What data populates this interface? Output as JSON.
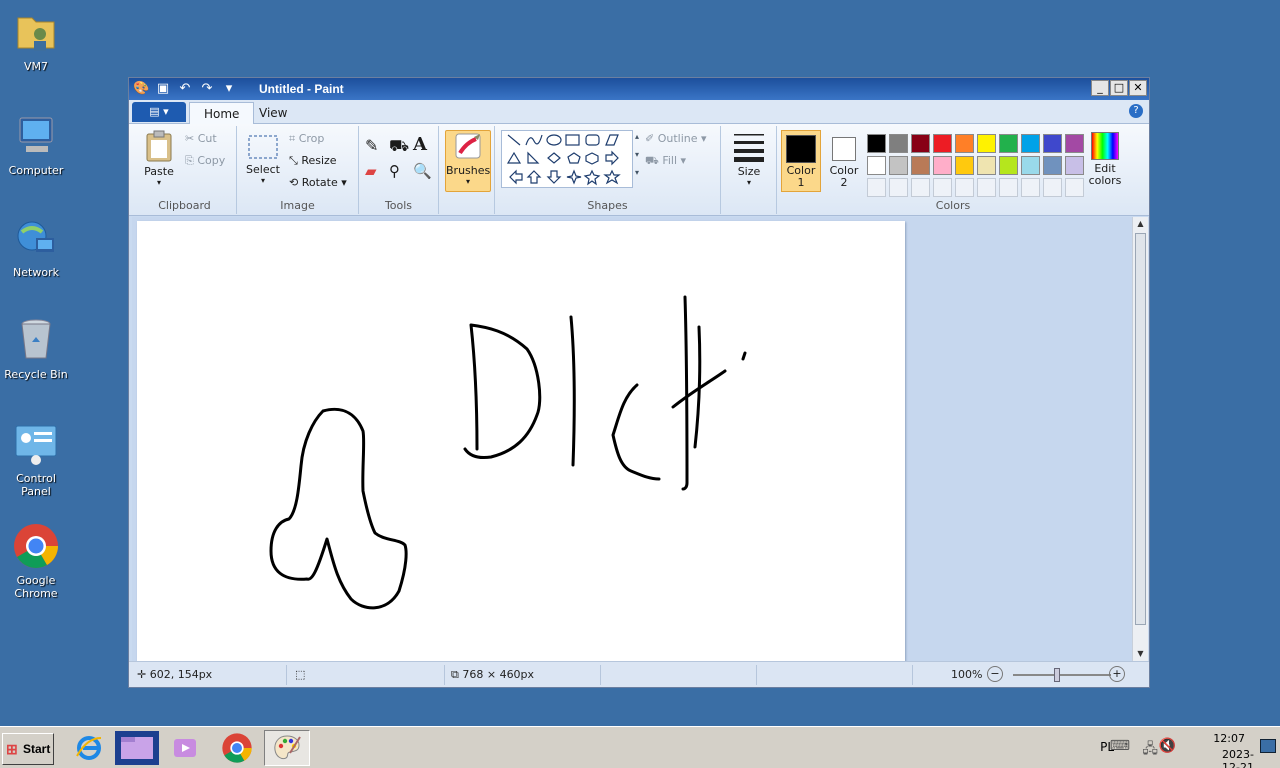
{
  "desktop": {
    "icons": [
      {
        "label": "VM7",
        "icon": "user-folder-icon"
      },
      {
        "label": "Computer",
        "icon": "computer-icon"
      },
      {
        "label": "Network",
        "icon": "network-icon"
      },
      {
        "label": "Recycle Bin",
        "icon": "recycle-bin-icon"
      },
      {
        "label": "Control Panel",
        "icon": "control-panel-icon"
      },
      {
        "label": "Google Chrome",
        "icon": "chrome-icon"
      }
    ]
  },
  "window": {
    "title": "Untitled - Paint",
    "tabs": [
      "Home",
      "View"
    ],
    "clipboard": {
      "paste": "Paste",
      "cut": "Cut",
      "copy": "Copy",
      "label": "Clipboard"
    },
    "image": {
      "select": "Select",
      "crop": "Crop",
      "resize": "Resize",
      "rotate": "Rotate",
      "label": "Image"
    },
    "tools": {
      "label": "Tools"
    },
    "brushes": {
      "label": "Brushes"
    },
    "shapes": {
      "outline": "Outline",
      "fill": "Fill",
      "label": "Shapes"
    },
    "size": {
      "label": "Size"
    },
    "colors": {
      "color1": "Color 1",
      "color2": "Color 2",
      "edit": "Edit colors",
      "label": "Colors",
      "color1_value": "#000000",
      "color2_value": "#ffffff",
      "palette_row1": [
        "#000000",
        "#7f7f7f",
        "#880015",
        "#ed1c24",
        "#ff7f27",
        "#fff200",
        "#22b14c",
        "#00a2e8",
        "#3f48cc",
        "#a349a4"
      ],
      "palette_row2": [
        "#ffffff",
        "#c3c3c3",
        "#b97a57",
        "#ffaec9",
        "#ffc90e",
        "#efe4b0",
        "#b5e61d",
        "#99d9ea",
        "#7092be",
        "#c8bfe7"
      ]
    },
    "status": {
      "cursor_pos": "602, 154px",
      "canvas_size": "768 × 460px",
      "zoom": "100%"
    }
  },
  "taskbar": {
    "start": "Start",
    "lang": "PL",
    "time": "12:07",
    "date": "2023-12-21"
  }
}
